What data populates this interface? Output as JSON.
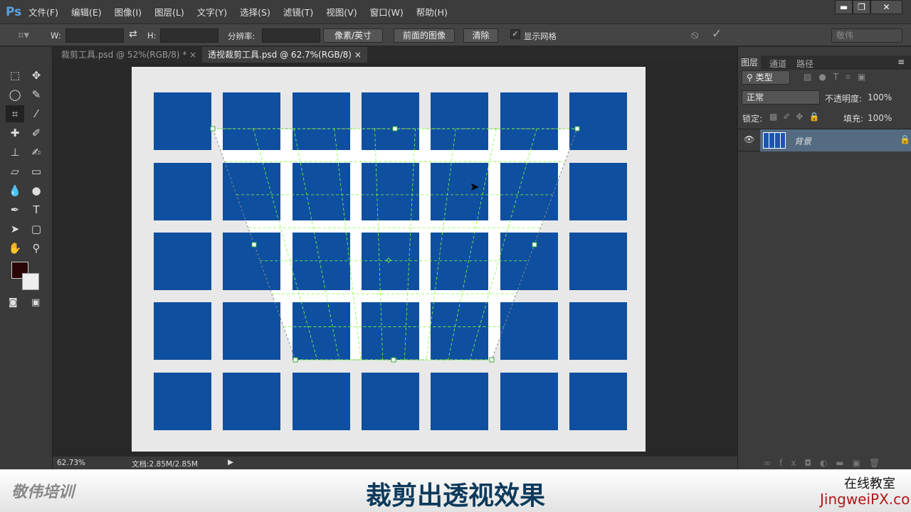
{
  "app": {
    "logo": "Ps",
    "menu": [
      "文件(F)",
      "编辑(E)",
      "图像(I)",
      "图层(L)",
      "文字(Y)",
      "选择(S)",
      "滤镜(T)",
      "视图(V)",
      "窗口(W)",
      "帮助(H)"
    ],
    "window_buttons": [
      "▬",
      "❐",
      "✕"
    ]
  },
  "options": {
    "w_label": "W:",
    "h_label": "H:",
    "resolution_label": "分辨率:",
    "unit": "像素/英寸",
    "front_image": "前面的图像",
    "clear": "清除",
    "show_grid": "显示网格",
    "show_grid_checked": true,
    "workspace": "敬伟"
  },
  "tabs": [
    {
      "label": "裁剪工具.psd @ 52%(RGB/8) *",
      "active": false
    },
    {
      "label": "透视裁剪工具.psd @ 62.7%(RGB/8)",
      "active": true
    }
  ],
  "layers_panel": {
    "tabs": [
      "图层",
      "通道",
      "路径"
    ],
    "filter": "类型",
    "blend_mode": "正常",
    "opacity_label": "不透明度:",
    "opacity": "100%",
    "lock_label": "锁定:",
    "fill_label": "填充:",
    "fill": "100%",
    "layers": [
      {
        "name": "背景",
        "locked": true,
        "visible": true
      }
    ]
  },
  "status": {
    "zoom": "62.73%",
    "doc": "文档:2.85M/2.85M"
  },
  "caption": {
    "brand_left": "敬伟培训",
    "title": "裁剪出透视效果",
    "right_top": "在线教室",
    "right_bottom": "JingweiPX.com"
  },
  "colors": {
    "tile": "#0f4fa0",
    "grid": "#7cff3c"
  }
}
